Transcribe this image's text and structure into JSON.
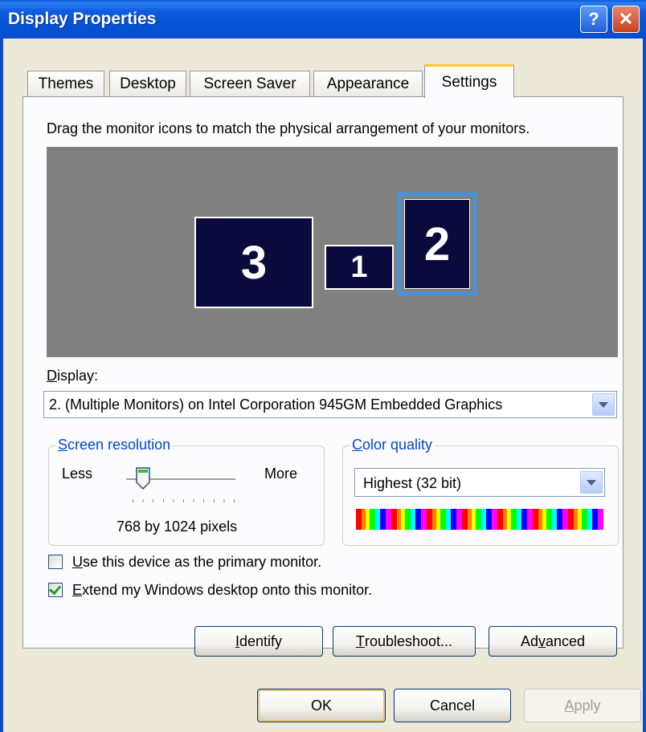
{
  "window": {
    "title": "Display Properties",
    "help_glyph": "?",
    "close_glyph": "✕"
  },
  "tabs": [
    {
      "label": "Themes"
    },
    {
      "label": "Desktop"
    },
    {
      "label": "Screen Saver"
    },
    {
      "label": "Appearance"
    },
    {
      "label": "Settings",
      "active": true
    }
  ],
  "settings": {
    "instruction": "Drag the monitor icons to match the physical arrangement of your monitors.",
    "monitors": [
      {
        "number": "3"
      },
      {
        "number": "1"
      },
      {
        "number": "2",
        "selected": true
      }
    ],
    "display_label_underlined": "D",
    "display_label_rest": "isplay:",
    "display_value": "2. (Multiple Monitors) on Intel Corporation 945GM Embedded Graphics",
    "screen_resolution": {
      "legend_underlined": "S",
      "legend_rest": "creen resolution",
      "less_label": "Less",
      "more_label": "More",
      "value_text": "768 by 1024 pixels"
    },
    "color_quality": {
      "legend_underlined": "C",
      "legend_rest": "olor quality",
      "value": "Highest (32 bit)"
    },
    "primary_checkbox": {
      "underlined": "U",
      "rest": "se this device as the primary monitor.",
      "checked": false
    },
    "extend_checkbox": {
      "underlined": "E",
      "rest": "xtend my Windows desktop onto this monitor.",
      "checked": true
    },
    "buttons": {
      "identify": {
        "underlined": "I",
        "rest": "dentify"
      },
      "troubleshoot": {
        "underlined": "T",
        "rest": "roubleshoot..."
      },
      "advanced": {
        "before": "Ad",
        "underlined": "v",
        "after": "anced"
      }
    }
  },
  "dialog_buttons": {
    "ok": "OK",
    "cancel": "Cancel",
    "apply_underlined": "A",
    "apply_rest": "pply"
  },
  "colors": {
    "title_bar": "#0553D6",
    "tab_highlight": "#FFC83C",
    "monitor_fill": "#0A0A3C",
    "selected_monitor_border": "#3D95E8"
  }
}
